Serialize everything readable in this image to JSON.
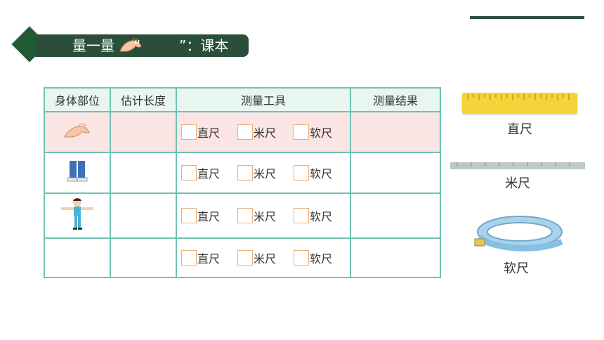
{
  "header": {
    "title_left": "量一量",
    "title_right": "”：课本",
    "quote_open": "“"
  },
  "table": {
    "headers": [
      "身体部位",
      "估计长度",
      "测量工具",
      "测量结果"
    ],
    "tool_labels": [
      "直尺",
      "米尺",
      "软尺"
    ],
    "rows": [
      {
        "body_part_icon": "hand-span-icon",
        "highlighted": true
      },
      {
        "body_part_icon": "legs-icon",
        "highlighted": false
      },
      {
        "body_part_icon": "arm-span-boy-icon",
        "highlighted": false
      },
      {
        "body_part_icon": "",
        "highlighted": false
      }
    ]
  },
  "side_tools": {
    "ruler_label": "直尺",
    "meter_stick_label": "米尺",
    "tape_label": "软尺"
  },
  "colors": {
    "title_bar": "#2b4e3a",
    "table_border": "#6cc3b4",
    "highlight_row": "#fbe4e4",
    "checkbox_border": "#e7b07d",
    "ruler_yellow": "#f5d43a",
    "tape_blue": "#a9d3ec"
  }
}
